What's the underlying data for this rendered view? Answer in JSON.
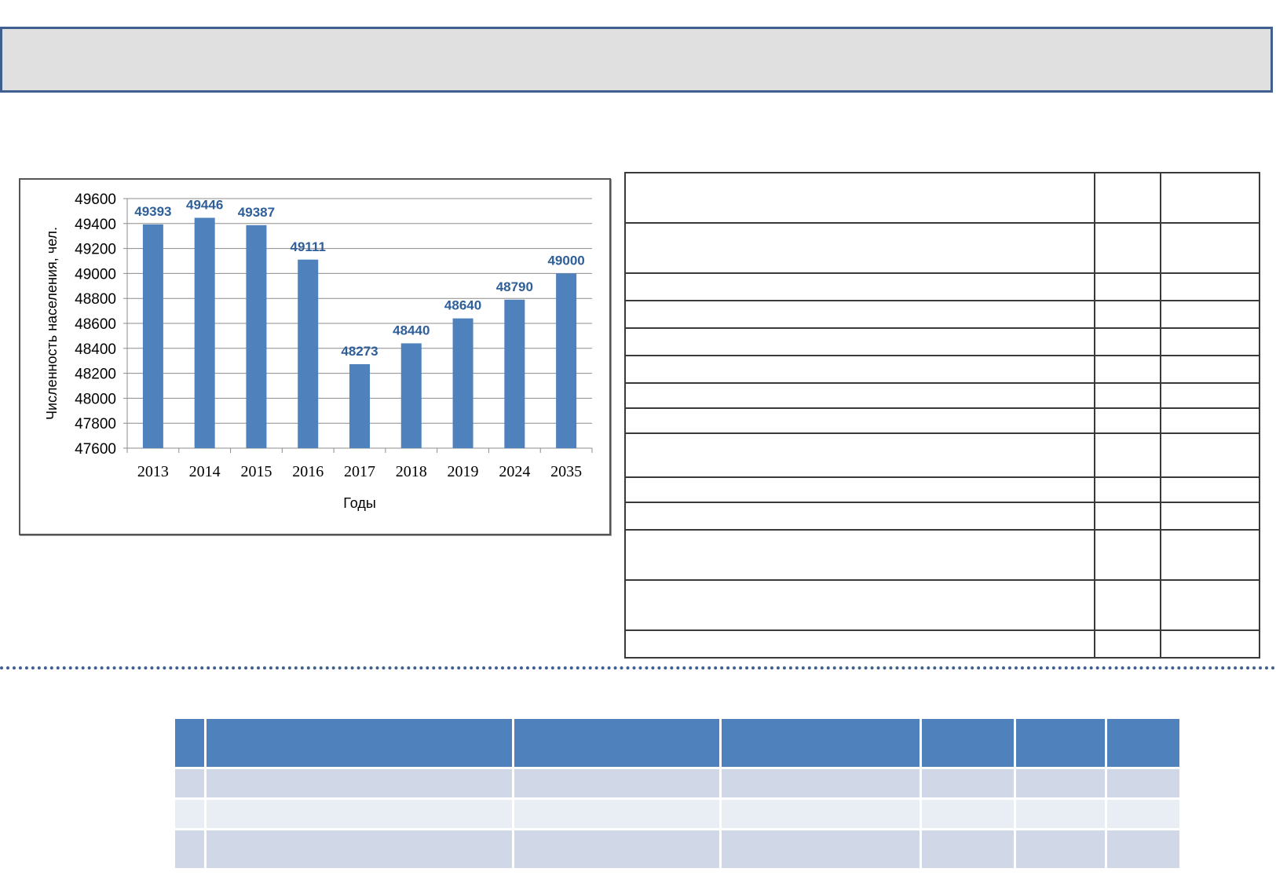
{
  "chart_data": {
    "type": "bar",
    "categories": [
      "2013",
      "2014",
      "2015",
      "2016",
      "2017",
      "2018",
      "2019",
      "2024",
      "2035"
    ],
    "values": [
      49393,
      49446,
      49387,
      49111,
      48273,
      48440,
      48640,
      48790,
      49000
    ],
    "data_labels": [
      "49393",
      "49446",
      "49387",
      "49111",
      "48273",
      "48440",
      "48640",
      "48790",
      "49000"
    ],
    "xlabel": "Годы",
    "ylabel": "Численность населения, чел.",
    "ylim": [
      47600,
      49600
    ],
    "yticks": [
      "49600",
      "49400",
      "49200",
      "49000",
      "48800",
      "48600",
      "48400",
      "48200",
      "48000",
      "47800",
      "47600"
    ],
    "grid": true,
    "legend": "none",
    "bar_color": "#4f81bd",
    "label_color": "#2f5f98"
  },
  "colors": {
    "title_bar_bg": "#e0e0e0",
    "title_bar_border": "#3f5f8f",
    "table_header": "#4f81bd",
    "table_row_dark": "#d0d8e8",
    "table_row_light": "#e9edf4"
  }
}
